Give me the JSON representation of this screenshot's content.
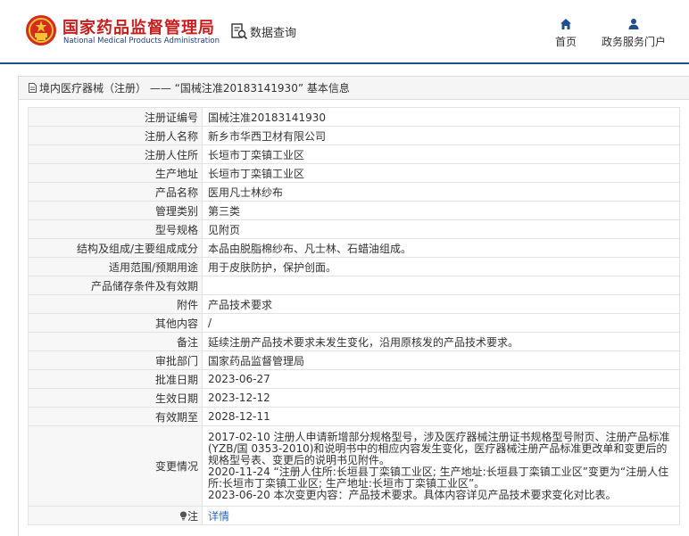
{
  "header": {
    "site_name_cn": "国家药品监督管理局",
    "site_name_en": "National Medical Products Administration",
    "query_label": "数据查询",
    "nav": {
      "home": "首页",
      "portal": "政务服务门户"
    }
  },
  "panel": {
    "title": "境内医疗器械（注册） —— “国械注准20183141930” 基本信息"
  },
  "fields": [
    {
      "label": "注册证编号",
      "value": "国械注准20183141930"
    },
    {
      "label": "注册人名称",
      "value": "新乡市华西卫材有限公司"
    },
    {
      "label": "注册人住所",
      "value": "长垣市丁栾镇工业区"
    },
    {
      "label": "生产地址",
      "value": "长垣市丁栾镇工业区"
    },
    {
      "label": "产品名称",
      "value": "医用凡士林纱布"
    },
    {
      "label": "管理类别",
      "value": "第三类"
    },
    {
      "label": "型号规格",
      "value": "见附页"
    },
    {
      "label": "结构及组成/主要组成成分",
      "value": "本品由脱脂棉纱布、凡士林、石蜡油组成。"
    },
    {
      "label": "适用范围/预期用途",
      "value": "用于皮肤防护，保护创面。"
    },
    {
      "label": "产品储存条件及有效期",
      "value": ""
    },
    {
      "label": "附件",
      "value": "产品技术要求"
    },
    {
      "label": "其他内容",
      "value": "/"
    },
    {
      "label": "备注",
      "value": "延续注册产品技术要求未发生变化，沿用原核发的产品技术要求。"
    },
    {
      "label": "审批部门",
      "value": "国家药品监督管理局"
    },
    {
      "label": "批准日期",
      "value": "2023-06-27"
    },
    {
      "label": "生效日期",
      "value": "2023-12-12"
    },
    {
      "label": "有效期至",
      "value": "2028-12-11"
    }
  ],
  "changes": {
    "label": "变更情况",
    "lines": [
      "2017-02-10 注册人申请新增部分规格型号，涉及医疗器械注册证书规格型号附页、注册产品标准(YZB/国 0353-2010)和说明书中的相应内容发生变化，医疗器械注册产品标准更改单和变更后的规格型号表、变更后的说明书见附件。",
      "2020-11-24 “注册人住所:长垣县丁栾镇工业区; 生产地址:长垣县丁栾镇工业区”变更为“注册人住所:长垣市丁栾镇工业区; 生产地址:长垣市丁栾镇工业区”。",
      "2023-06-20 本次变更内容：产品技术要求。具体内容详见产品技术要求变化对比表。"
    ]
  },
  "note": {
    "label": "注",
    "link": "详情",
    "icon": "lightbulb-icon"
  },
  "colors": {
    "brand_red": "#c81e1e",
    "brand_blue": "#1f4f8f",
    "link": "#2a6bc9"
  }
}
